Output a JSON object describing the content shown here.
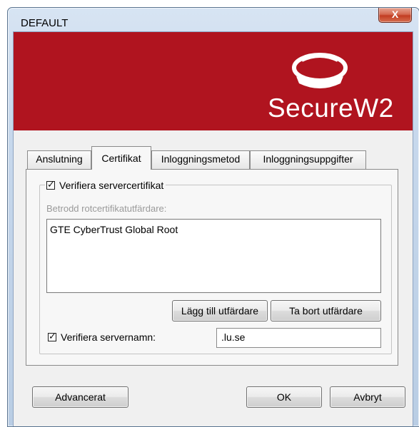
{
  "window": {
    "title": "DEFAULT",
    "close_label": "X"
  },
  "banner": {
    "brand_name": "SecureW2",
    "brand_color": "#b0141f"
  },
  "tabs": [
    {
      "label": "Anslutning",
      "active": false
    },
    {
      "label": "Certifikat",
      "active": true
    },
    {
      "label": "Inloggningsmetod",
      "active": false
    },
    {
      "label": "Inloggningsuppgifter",
      "active": false
    }
  ],
  "certificate": {
    "verify_server_cert_label": "Verifiera servercertifikat",
    "verify_server_cert_checked": true,
    "trusted_root_label": "Betrodd rotcertifikatutfärdare:",
    "trusted_roots": [
      "GTE CyberTrust Global Root"
    ],
    "add_issuer_label": "Lägg till utfärdare",
    "remove_issuer_label": "Ta bort utfärdare",
    "verify_server_name_label": "Verifiera servernamn:",
    "verify_server_name_checked": true,
    "server_name_value": ".lu.se"
  },
  "footer": {
    "advanced_label": "Advancerat",
    "ok_label": "OK",
    "cancel_label": "Avbryt"
  }
}
